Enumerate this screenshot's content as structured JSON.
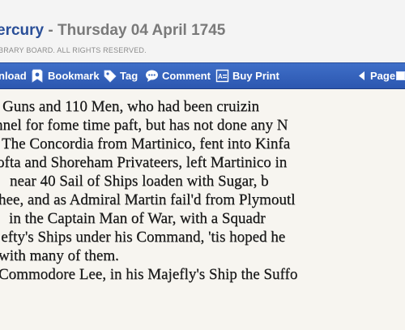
{
  "header": {
    "publication": "ercury",
    "separator": " - ",
    "date": "Thursday 04 April 1745",
    "copyright": "BRARY BOARD. ALL RIGHTS RESERVED."
  },
  "toolbar": {
    "download_label": "nload",
    "bookmark_label": "Bookmark",
    "tag_label": "Tag",
    "comment_label": "Comment",
    "buy_print_label": "Buy Print",
    "page_label": "Page"
  },
  "colors": {
    "title": "#2a4f98",
    "toolbar": "#3564be",
    "date_text": "#7a7a7a"
  },
  "icons": {
    "bookmark": "bookmark-icon",
    "tag": "tag-icon",
    "comment": "comment-icon",
    "buy_print": "print-icon",
    "page_nav": "chevron-left-icon"
  },
  "article": {
    "lines": [
      "Guns and 110 Men, who had been cruizin",
      "nnel for fome time paft, but has not done any N",
      "The Concordia from Martinico, fent into Kinfa",
      "ofta and Shoreham Privateers, left Martinico in",
      "near 40 Sail of Ships loaden with Sugar, b",
      "hee, and as Admiral Martin fail'd from Plymoutl",
      "in the Captain Man of War, with a Squadr",
      "jefty's Ships under his Command, 'tis hoped he",
      "with many of them.",
      "Commodore Lee, in his Majefly's Ship the Suffo"
    ]
  }
}
